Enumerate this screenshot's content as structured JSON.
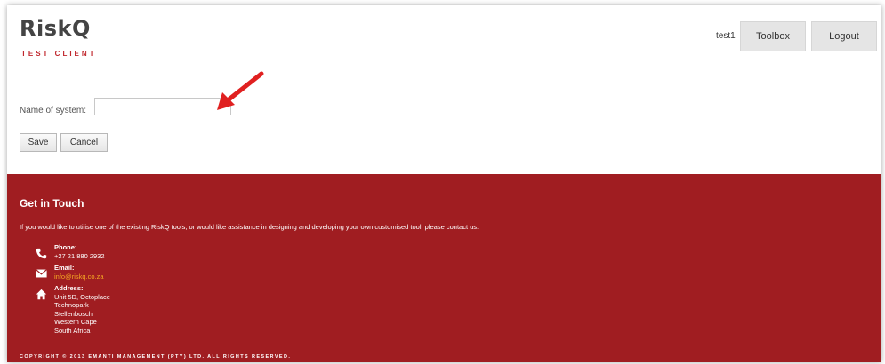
{
  "header": {
    "logo": "RiskQ",
    "logo_sub": "TEST CLIENT",
    "user": "test1",
    "toolbox_label": "Toolbox",
    "logout_label": "Logout"
  },
  "form": {
    "name_label": "Name of system:",
    "name_value": "",
    "save_label": "Save",
    "cancel_label": "Cancel"
  },
  "footer": {
    "title": "Get in Touch",
    "intro": "If you would like to utilise one of the existing RiskQ tools, or would like assistance in designing and developing your own customised tool, please contact us.",
    "phone": {
      "heading": "Phone:",
      "value": "+27 21 880 2932",
      "icon": "phone-icon"
    },
    "email": {
      "heading": "Email:",
      "value": "info@riskq.co.za",
      "icon": "envelope-icon"
    },
    "address": {
      "heading": "Address:",
      "lines": [
        "Unit 5D, Octoplace",
        "Technopark",
        "Stellenbosch",
        "Western Cape",
        "South Africa"
      ],
      "icon": "home-icon"
    },
    "copyright": "COPYRIGHT © 2013 EMANTI MANAGEMENT (PTY) LTD. ALL RIGHTS RESERVED."
  },
  "colors": {
    "brand_red": "#a01d21",
    "logo_sub_red": "#c0272d",
    "arrow_red": "#e02020",
    "email_link": "#f5a623"
  }
}
